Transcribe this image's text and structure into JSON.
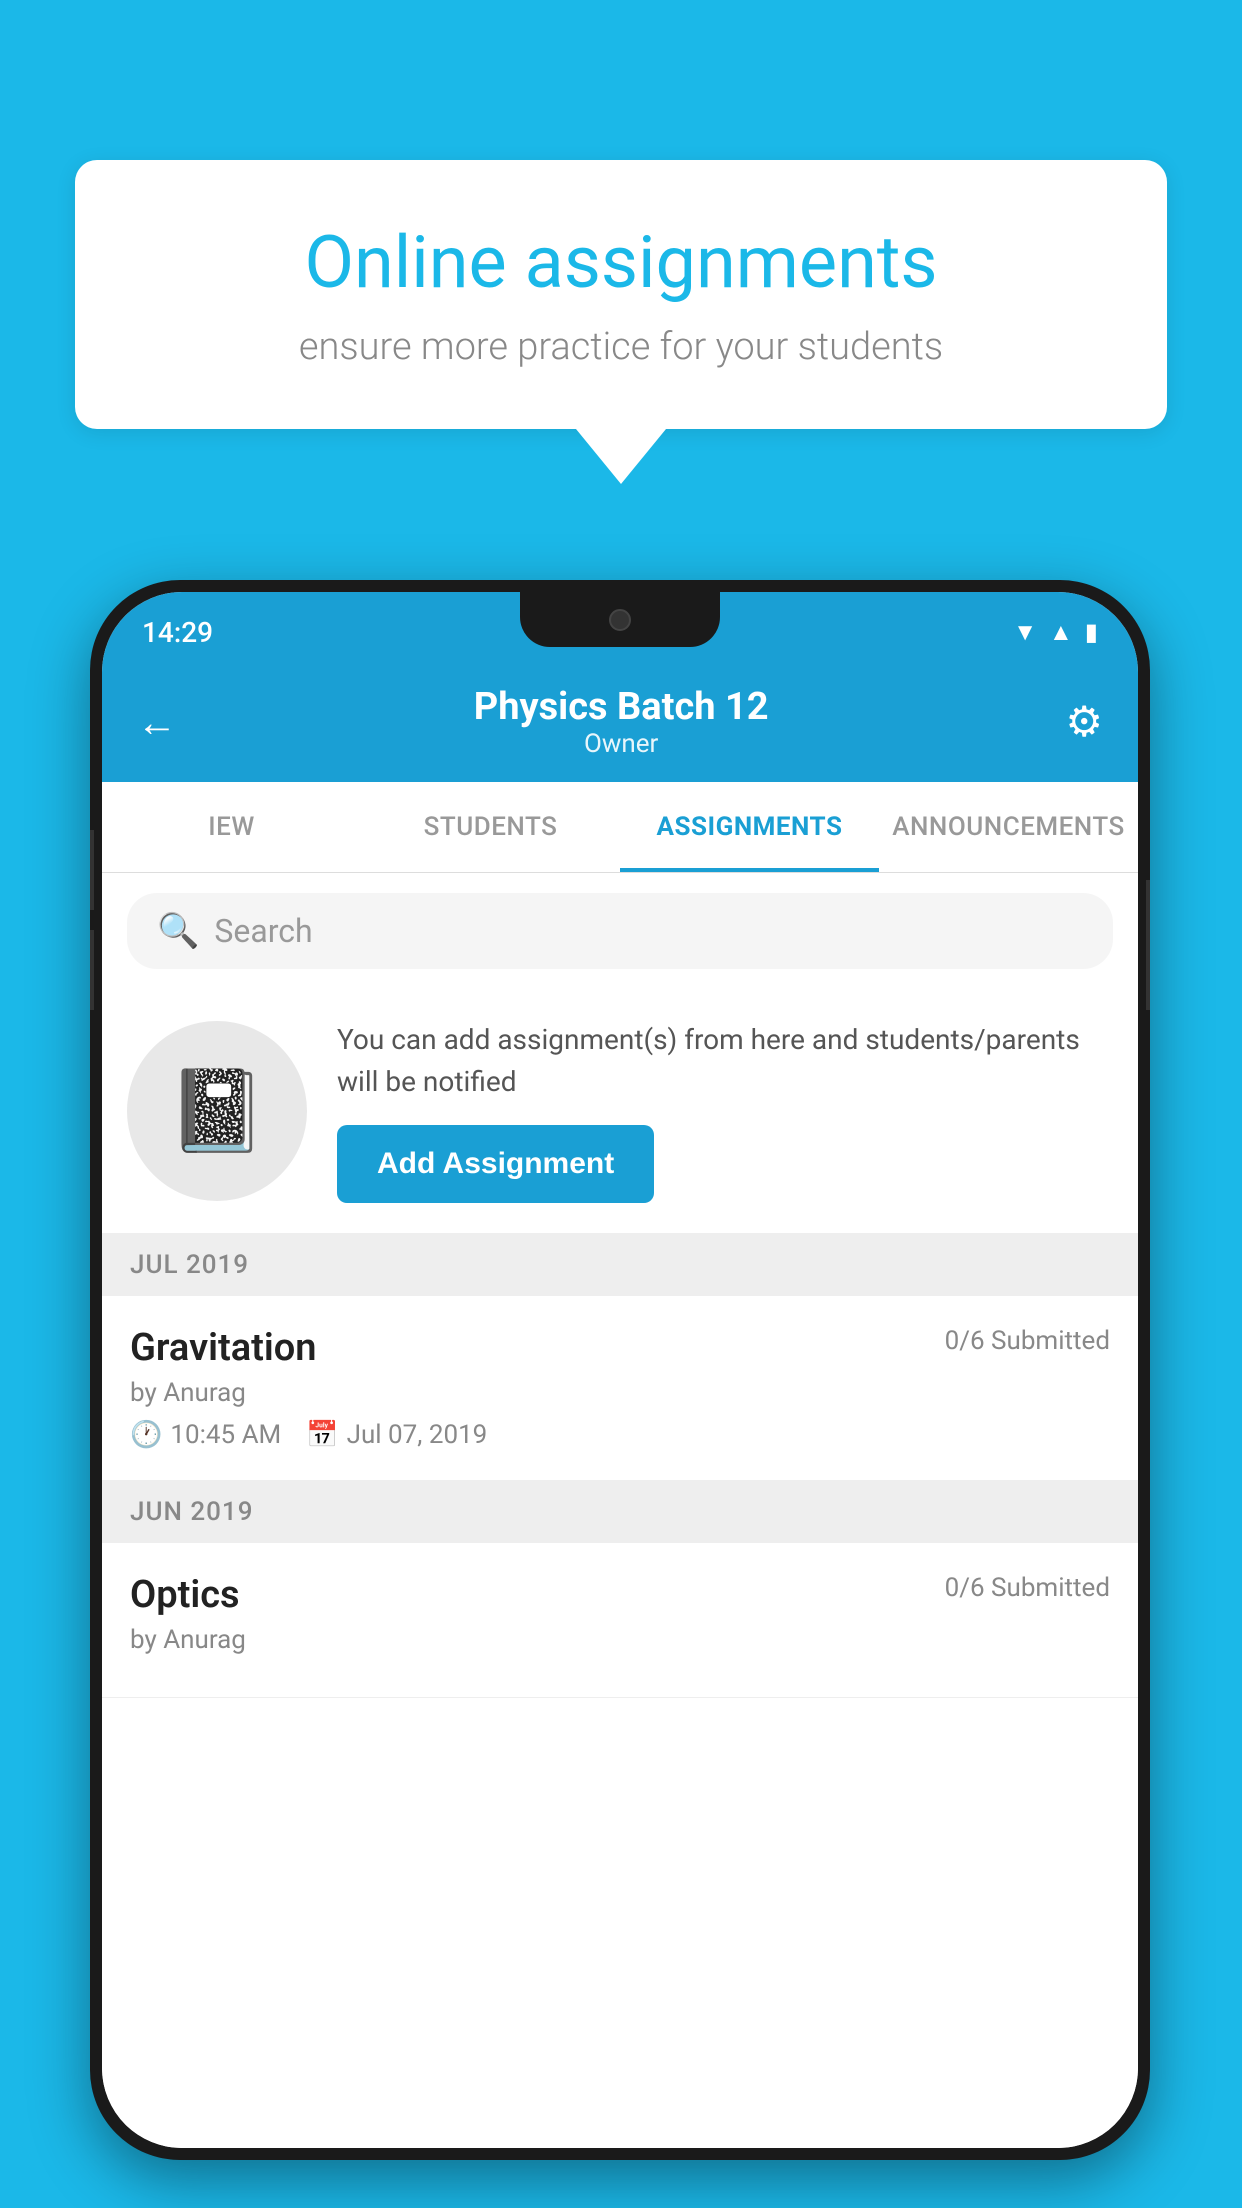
{
  "background_color": "#1BB8E8",
  "speech_bubble": {
    "title": "Online assignments",
    "subtitle": "ensure more practice for your students"
  },
  "status_bar": {
    "time": "14:29",
    "icons": [
      "wifi",
      "signal",
      "battery"
    ]
  },
  "header": {
    "title": "Physics Batch 12",
    "subtitle": "Owner",
    "back_label": "←",
    "settings_label": "⚙"
  },
  "tabs": [
    {
      "label": "IEW",
      "active": false
    },
    {
      "label": "STUDENTS",
      "active": false
    },
    {
      "label": "ASSIGNMENTS",
      "active": true
    },
    {
      "label": "ANNOUNCEMENTS",
      "active": false
    }
  ],
  "search": {
    "placeholder": "Search"
  },
  "add_assignment_section": {
    "description": "You can add assignment(s) from here and students/parents will be notified",
    "button_label": "Add Assignment"
  },
  "months": [
    {
      "label": "JUL 2019",
      "assignments": [
        {
          "name": "Gravitation",
          "submitted": "0/6 Submitted",
          "by": "by Anurag",
          "time": "10:45 AM",
          "date": "Jul 07, 2019"
        }
      ]
    },
    {
      "label": "JUN 2019",
      "assignments": [
        {
          "name": "Optics",
          "submitted": "0/6 Submitted",
          "by": "by Anurag",
          "time": "",
          "date": ""
        }
      ]
    }
  ]
}
